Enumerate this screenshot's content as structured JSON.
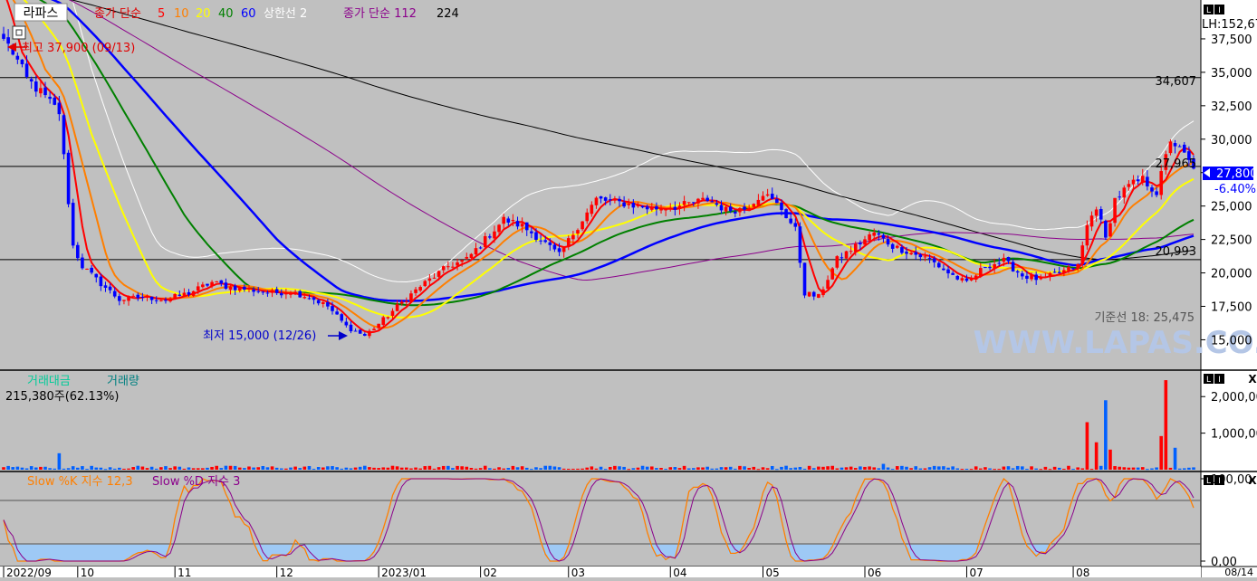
{
  "header": {
    "name": "라파스",
    "ma_label": "종가 단순",
    "ma_periods": [
      "5",
      "10",
      "20",
      "40",
      "60"
    ],
    "ma_colors": [
      "#ff0000",
      "#ff7f00",
      "#ffff00",
      "#008000",
      "#0000ff"
    ],
    "envelope_label": "상한선 2",
    "long_ma_label": "종가 단순 112",
    "long_ma_2": "224"
  },
  "price_panel": {
    "high_annotation": "최고 37,900 (09/13)",
    "low_annotation": "최저 15,000 (12/26)",
    "hline_labels": [
      "34,607",
      "27,965",
      "20,993"
    ],
    "current_price": "27,800",
    "change_pct": "-6.40%",
    "lh_label": "LH:152,67",
    "kijun_label": "기준선 18: 25,475",
    "watermark": "WWW.LAPAS.CO.KR",
    "y_ticks": [
      "37,500",
      "35,000",
      "32,500",
      "30,000",
      "27,500",
      "25,000",
      "22,500",
      "20,000",
      "17,500",
      "15,000"
    ]
  },
  "volume_panel": {
    "legend_1": "거래대금",
    "legend_2": "거래량",
    "current": "215,380주(62.13%)",
    "y_ticks": [
      "2,000,00",
      "1,000,00"
    ]
  },
  "stoch_panel": {
    "legend_k": "Slow %K 지수 12,3",
    "legend_d": "Slow %D 지수 3",
    "y_ticks": [
      "100,00",
      "0,00"
    ]
  },
  "x_axis": {
    "labels": [
      "2022/09",
      "10",
      "11",
      "12",
      "2023/01",
      "02",
      "03",
      "04",
      "05",
      "06",
      "07",
      "08"
    ],
    "right_label": "08/14"
  },
  "controls": {
    "panel_btn_1": "L",
    "panel_btn_2": "I",
    "panel_close": "X"
  },
  "chart_data": {
    "type": "candlestick",
    "price_range": [
      13000,
      40000
    ],
    "price_key_points": [
      [
        0,
        37500
      ],
      [
        2,
        36500
      ],
      [
        5,
        34500
      ],
      [
        8,
        33500
      ],
      [
        12,
        32000
      ],
      [
        15,
        22000
      ],
      [
        17,
        20500
      ],
      [
        20,
        19500
      ],
      [
        25,
        18000
      ],
      [
        30,
        18200
      ],
      [
        35,
        18000
      ],
      [
        40,
        18500
      ],
      [
        45,
        19300
      ],
      [
        48,
        19000
      ],
      [
        52,
        18800
      ],
      [
        58,
        18500
      ],
      [
        62,
        18600
      ],
      [
        66,
        18200
      ],
      [
        70,
        17500
      ],
      [
        74,
        16000
      ],
      [
        78,
        15300
      ],
      [
        82,
        16500
      ],
      [
        86,
        17800
      ],
      [
        90,
        19000
      ],
      [
        96,
        20500
      ],
      [
        100,
        21000
      ],
      [
        104,
        22500
      ],
      [
        108,
        24000
      ],
      [
        112,
        23500
      ],
      [
        116,
        22500
      ],
      [
        120,
        21300
      ],
      [
        124,
        23500
      ],
      [
        128,
        25500
      ],
      [
        134,
        25200
      ],
      [
        140,
        24800
      ],
      [
        146,
        25000
      ],
      [
        152,
        25500
      ],
      [
        156,
        24700
      ],
      [
        160,
        24800
      ],
      [
        164,
        26000
      ],
      [
        168,
        24800
      ],
      [
        171,
        23200
      ],
      [
        173,
        18500
      ],
      [
        176,
        18200
      ],
      [
        180,
        21000
      ],
      [
        184,
        22000
      ],
      [
        188,
        23000
      ],
      [
        192,
        22000
      ],
      [
        196,
        21500
      ],
      [
        200,
        21000
      ],
      [
        204,
        20000
      ],
      [
        208,
        19200
      ],
      [
        212,
        20500
      ],
      [
        216,
        20900
      ],
      [
        220,
        19800
      ],
      [
        224,
        19500
      ],
      [
        228,
        20000
      ],
      [
        232,
        20500
      ],
      [
        234,
        23500
      ],
      [
        236,
        25000
      ],
      [
        238,
        22500
      ],
      [
        240,
        25500
      ],
      [
        243,
        26500
      ],
      [
        246,
        27000
      ],
      [
        249,
        26000
      ],
      [
        252,
        30000
      ],
      [
        255,
        28800
      ],
      [
        257,
        27800
      ]
    ],
    "ma_periods": [
      5,
      10,
      20,
      40,
      60,
      112,
      224
    ],
    "hlines": [
      34607,
      27965,
      20993
    ],
    "volume_range": [
      0,
      2600000
    ],
    "volume_spikes": [
      [
        12,
        450000
      ],
      [
        190,
        160000
      ],
      [
        234,
        1300000
      ],
      [
        236,
        750000
      ],
      [
        238,
        1900000
      ],
      [
        239,
        550000
      ],
      [
        250,
        920000
      ],
      [
        251,
        2450000
      ],
      [
        253,
        600000
      ]
    ],
    "stoch_range": [
      0,
      100
    ],
    "stoch_levels": [
      80,
      20
    ],
    "n_bars": 258
  }
}
